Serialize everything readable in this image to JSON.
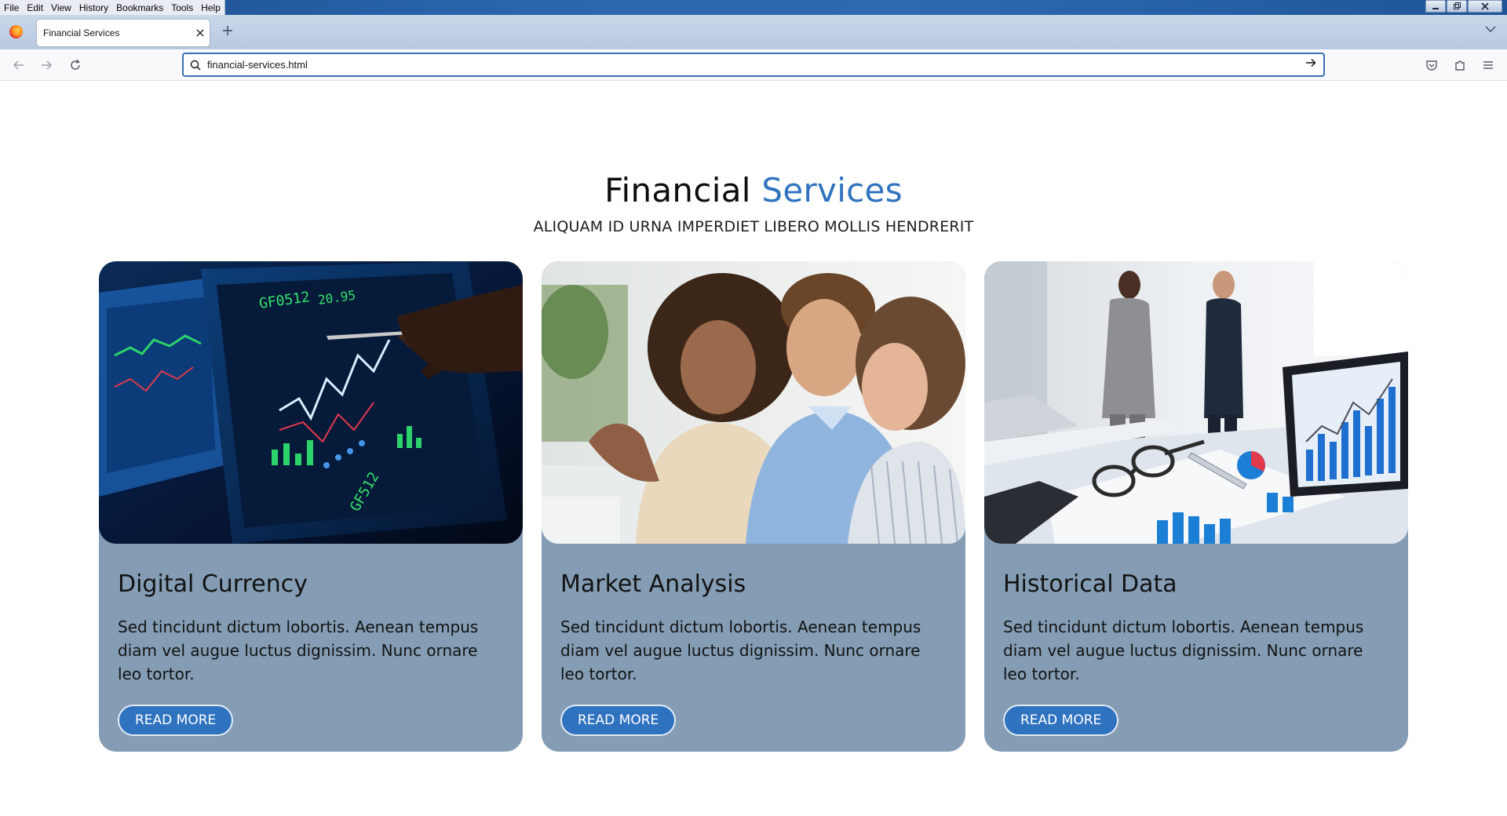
{
  "menubar": {
    "items": [
      "File",
      "Edit",
      "View",
      "History",
      "Bookmarks",
      "Tools",
      "Help"
    ]
  },
  "window_controls": {
    "minimize_icon": "minimize-icon",
    "restore_icon": "restore-icon",
    "close_icon": "close-icon"
  },
  "tabstrip": {
    "active_tab": {
      "title": "Financial Services"
    },
    "close_tab_icon": "close-icon",
    "new_tab_icon": "plus-icon",
    "list_tabs_icon": "chevron-down-icon"
  },
  "navbar": {
    "url": "financial-services.html",
    "icons": [
      "back-arrow-icon",
      "forward-arrow-icon",
      "reload-icon",
      "search-icon",
      "go-arrow-icon",
      "pocket-icon",
      "extensions-icon",
      "hamburger-menu-icon"
    ]
  },
  "page": {
    "heading_main": "Financial",
    "heading_accent": "Services",
    "subheading": "ALIQUAM ID URNA IMPERDIET LIBERO MOLLIS HENDRERIT",
    "cards": [
      {
        "title": "Digital Currency",
        "text": "Sed tincidunt dictum lobortis. Aenean tempus diam vel augue luctus dignissim. Nunc ornare leo tortor.",
        "button": "READ MORE"
      },
      {
        "title": "Market Analysis",
        "text": "Sed tincidunt dictum lobortis. Aenean tempus diam vel augue luctus dignissim. Nunc ornare leo tortor.",
        "button": "READ MORE"
      },
      {
        "title": "Historical Data",
        "text": "Sed tincidunt dictum lobortis. Aenean tempus diam vel augue luctus dignissim. Nunc ornare leo tortor.",
        "button": "READ MORE"
      }
    ]
  },
  "colors": {
    "accent": "#2f73bf",
    "card_background": "#849db4",
    "button_background": "#2f72bf"
  }
}
